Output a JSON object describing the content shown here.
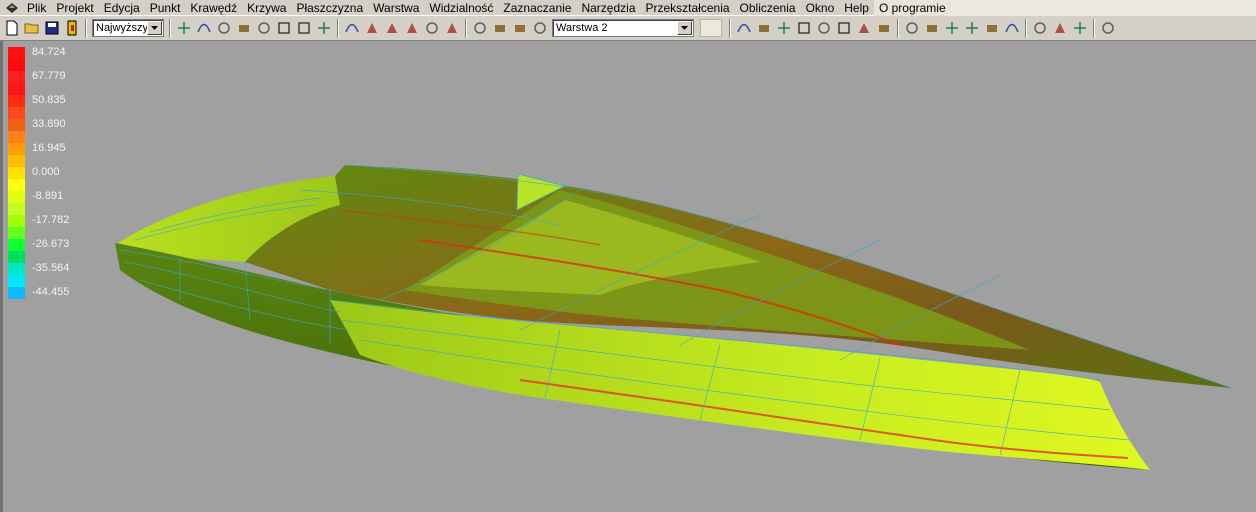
{
  "menu": {
    "items": [
      "Plik",
      "Projekt",
      "Edycja",
      "Punkt",
      "Krawędź",
      "Krzywa",
      "Płaszczyzna",
      "Warstwa",
      "Widzialność",
      "Zaznaczanie",
      "Narzędzia",
      "Przekształcenia",
      "Obliczenia",
      "Okno",
      "Help",
      "O programie"
    ],
    "active_item": "O programie"
  },
  "toolbar": {
    "quality_select": "Najwyższy",
    "layer_select": "Warstwa 2",
    "tools_group1": [
      "new-file-icon",
      "open-folder-icon",
      "save-disk-icon",
      "exit-icon"
    ],
    "tools_group2": [
      "point-grid-icon",
      "edge-curve-icon",
      "surface-select-icon",
      "globe-render-icon",
      "mesh-grid-icon",
      "sphere-icon",
      "wave-surface-icon",
      "lines-3d-icon"
    ],
    "tools_group3": [
      "document-settings-icon",
      "plane-shape-icon",
      "edge-loop-icon",
      "join-edge-icon",
      "curve-tool-icon",
      "sweep-curve-icon"
    ],
    "tools_group4": [
      "cross-section-icon",
      "fill-tool-icon",
      "color-map-icon",
      "layer-grid-icon"
    ],
    "tools_group5": [
      "hull-shape-icon",
      "move-point-icon",
      "align-points-icon",
      "flag-marker-icon",
      "mirror-plane-icon",
      "lock-icon",
      "unlock-icon",
      "group-objects-icon"
    ],
    "tools_group6": [
      "measure-icon",
      "dimension-icon",
      "distance-icon",
      "cube-icon",
      "barrel-icon",
      "curved-surface-icon"
    ],
    "tools_group7": [
      "curve-join-icon",
      "light-icon",
      "camera-icon"
    ],
    "tools_group8": [
      "shader-render-icon"
    ]
  },
  "legend": {
    "labels": [
      "84.724",
      "67.779",
      "50.835",
      "33.890",
      "16.945",
      "0.000",
      "-8.891",
      "-17.782",
      "-26.673",
      "-35.564",
      "-44.455"
    ],
    "colors": [
      "#ff1010",
      "#ff0a0a",
      "#ff1e1e",
      "#ff1616",
      "#ff2c14",
      "#ff4818",
      "#f06010",
      "#ff8018",
      "#ff9c08",
      "#ffbe00",
      "#ffe000",
      "#ffff10",
      "#e0ff10",
      "#c0ff20",
      "#a0ff00",
      "#60ff20",
      "#10ff30",
      "#00e060",
      "#00e8c8",
      "#00e8ff",
      "#10b8ff",
      "#2090ff",
      "#1050ff",
      "#2020e0",
      "#2828ff",
      "#6010ff"
    ]
  },
  "viewport": {
    "model": "hull-surface"
  },
  "colors": {
    "window_gray": "#d4d0c8",
    "viewport_bg": "#a0a0a0",
    "hull_green": "#6e9e18",
    "deck_yellow": "#d8f020",
    "bottom_brown": "#7a6020",
    "wire_cyan": "#3aa8c8"
  }
}
